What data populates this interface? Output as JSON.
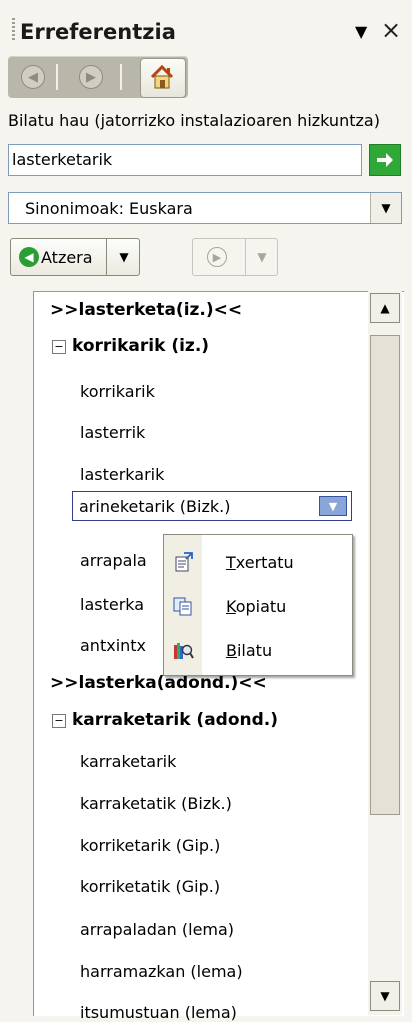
{
  "pane": {
    "title": "Erreferentzia",
    "dropdown_glyph": "▼",
    "close_glyph": "×"
  },
  "nav": {
    "back_icon": "back-arrow-icon",
    "forward_icon": "forward-arrow-icon",
    "home_icon": "home-icon"
  },
  "search": {
    "label": "Bilatu hau (jatorrizko instalazioaren hizkuntza)",
    "value": "lasterketarik",
    "go_icon": "go-arrow-icon"
  },
  "source": {
    "selected": "Sinonimoak: Euskara"
  },
  "toolbar": {
    "back_label": "Atzera"
  },
  "results": {
    "rows": [
      {
        "kind": "head",
        "text": ">>lasterketa(iz.)<<"
      },
      {
        "kind": "group",
        "text": "korrikarik (iz.)"
      },
      {
        "kind": "item",
        "text": "korrikarik"
      },
      {
        "kind": "item",
        "text": "lasterrik"
      },
      {
        "kind": "item",
        "text": "lasterkarik"
      },
      {
        "kind": "selected",
        "text": "arineketarik (Bizk.)"
      },
      {
        "kind": "item",
        "text": "arrapala"
      },
      {
        "kind": "item",
        "text": "lasterka"
      },
      {
        "kind": "item",
        "text": "antxintx"
      },
      {
        "kind": "head",
        "text": ">>lasterka(adond.)<<"
      },
      {
        "kind": "group",
        "text": "karraketarik (adond.)"
      },
      {
        "kind": "item",
        "text": "karraketarik"
      },
      {
        "kind": "item",
        "text": "karraketatik (Bizk.)"
      },
      {
        "kind": "item",
        "text": "korriketarik (Gip.)"
      },
      {
        "kind": "item",
        "text": "korriketatik (Gip.)"
      },
      {
        "kind": "item",
        "text": "arrapaladan (lema)"
      },
      {
        "kind": "item",
        "text": "harramazkan (lema)"
      },
      {
        "kind": "item",
        "text": "itsumustuan (lema)"
      }
    ]
  },
  "context_menu": {
    "items": [
      {
        "accel": "T",
        "rest": "xertatu",
        "icon": "insert-icon"
      },
      {
        "accel": "K",
        "rest": "opiatu",
        "icon": "copy-icon"
      },
      {
        "accel": "B",
        "rest": "ilatu",
        "icon": "search-icon"
      }
    ]
  },
  "colors": {
    "background": "#f5f4ee",
    "go_button": "#2fa837",
    "selection_border": "#32408a",
    "dropdown_blue": "#8aa6d8"
  }
}
